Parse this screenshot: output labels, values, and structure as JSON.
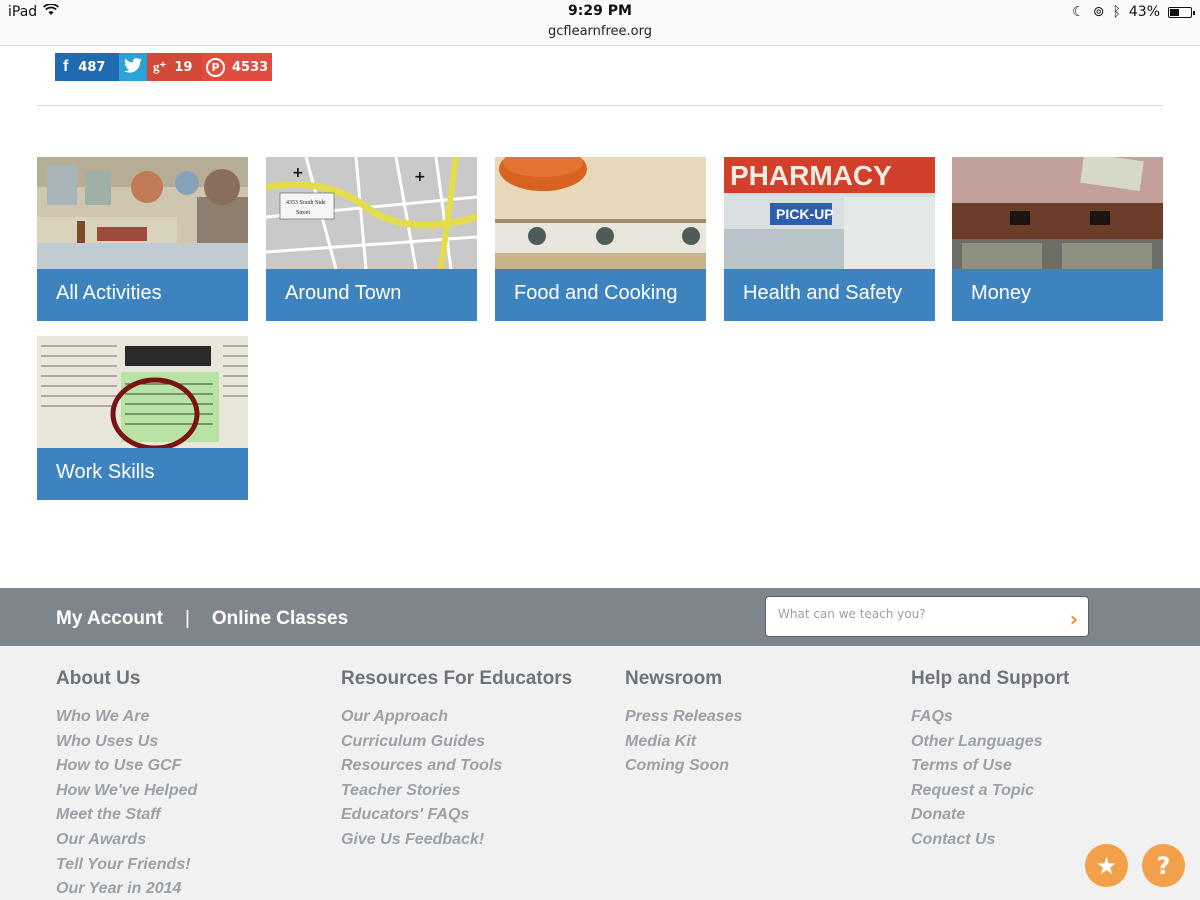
{
  "status_bar": {
    "device": "iPad",
    "time": "9:29 PM",
    "url": "gcflearnfree.org",
    "battery": "43%",
    "battery_level": 0.43
  },
  "share": {
    "facebook_count": "487",
    "googleplus_count": "19",
    "pinterest_count": "4533"
  },
  "tiles": [
    {
      "label": "All Activities"
    },
    {
      "label": "Around Town"
    },
    {
      "label": "Food and Cooking"
    },
    {
      "label": "Health and Safety"
    },
    {
      "label": "Money"
    },
    {
      "label": "Work Skills"
    }
  ],
  "footer_bar": {
    "my_account": "My Account",
    "separator": "|",
    "online_classes": "Online Classes",
    "search_placeholder": "What can we teach you?"
  },
  "footer": {
    "about": {
      "title": "About Us",
      "links": [
        "Who We Are",
        "Who Uses Us",
        "How to Use GCF",
        "How We've Helped",
        "Meet the Staff",
        "Our Awards",
        "Tell Your Friends!",
        "Our Year in 2014"
      ]
    },
    "educators": {
      "title": "Resources For Educators",
      "links": [
        "Our Approach",
        "Curriculum Guides",
        "Resources and Tools",
        "Teacher Stories",
        "Educators' FAQs",
        "Give Us Feedback!"
      ]
    },
    "newsroom": {
      "title": "Newsroom",
      "links": [
        "Press Releases",
        "Media Kit",
        "Coming Soon"
      ]
    },
    "help": {
      "title": "Help and Support",
      "links": [
        "FAQs",
        "Other Languages",
        "Terms of Use",
        "Request a Topic",
        "Donate",
        "Contact Us"
      ]
    }
  },
  "colors": {
    "tile_band": "#3d83c0",
    "footer_bar": "#7f858c",
    "accent_orange": "#f0902a"
  }
}
